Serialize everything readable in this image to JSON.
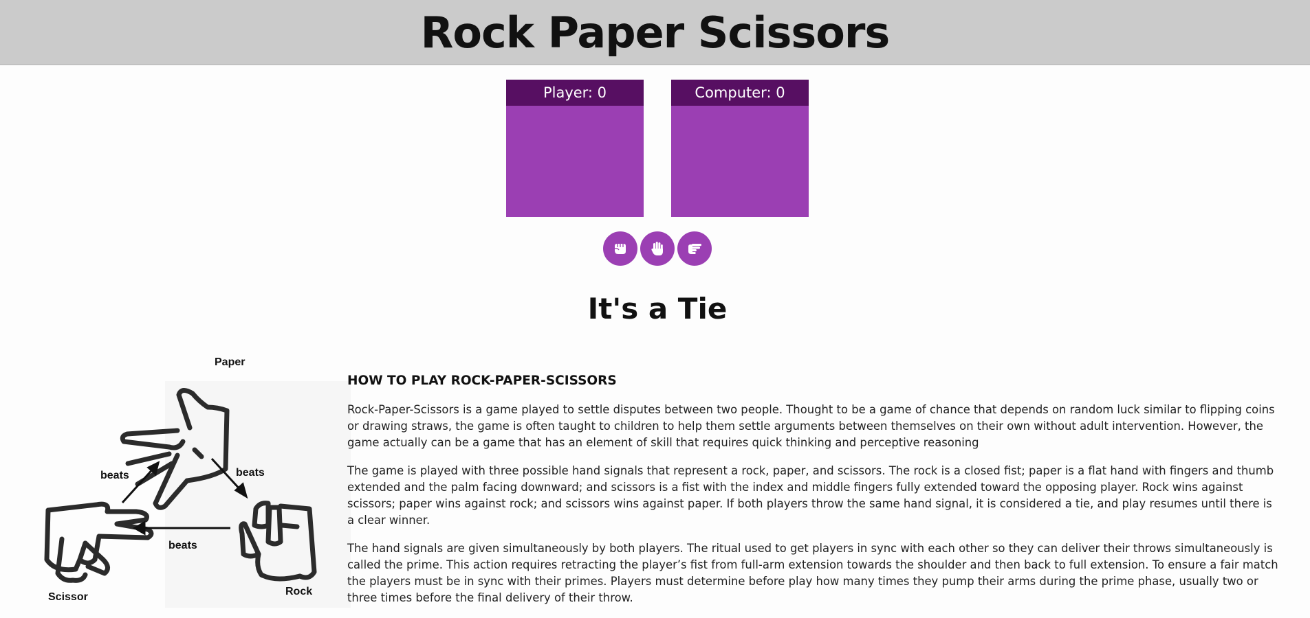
{
  "header": {
    "title": "Rock Paper Scissors"
  },
  "scoreboard": {
    "player_label": "Player: 0",
    "computer_label": "Computer: 0"
  },
  "choices": [
    {
      "name": "rock",
      "icon": "fist-icon"
    },
    {
      "name": "paper",
      "icon": "open-hand-icon"
    },
    {
      "name": "scissors",
      "icon": "scissors-hand-icon"
    }
  ],
  "result": {
    "text": "It's a Tie"
  },
  "diagram": {
    "labels": {
      "paper": "Paper",
      "rock": "Rock",
      "scissor": "Scissor",
      "beats_1": "beats",
      "beats_2": "beats",
      "beats_3": "beats"
    }
  },
  "rules": {
    "heading": "HOW TO PLAY ROCK-PAPER-SCISSORS",
    "paragraphs": [
      "Rock-Paper-Scissors is a game played to settle disputes between two people. Thought to be a game of chance that depends on random luck similar to flipping coins or drawing straws, the game is often taught to children to help them settle arguments between themselves on their own without adult intervention. However, the game actually can be a game that has an element of skill that requires quick thinking and perceptive reasoning",
      "The game is played with three possible hand signals that represent a rock, paper, and scissors. The rock is a closed fist; paper is a flat hand with fingers and thumb extended and the palm facing downward; and scissors is a fist with the index and middle fingers fully extended toward the opposing player. Rock wins against scissors; paper wins against rock; and scissors wins against paper. If both players throw the same hand signal, it is considered a tie, and play resumes until there is a clear winner.",
      "The hand signals are given simultaneously by both players. The ritual used to get players in sync with each other so they can deliver their throws simultaneously is called the prime. This action requires retracting the player’s fist from full-arm extension towards the shoulder and then back to full extension. To ensure a fair match the players must be in sync with their primes. Players must determine before play how many times they pump their arms during the prime phase, usually two or three times before the final delivery of their throw."
    ]
  },
  "colors": {
    "header_bg": "#cbcbcb",
    "card_bg": "#9b3fb3",
    "card_label_bg": "#570f62"
  }
}
